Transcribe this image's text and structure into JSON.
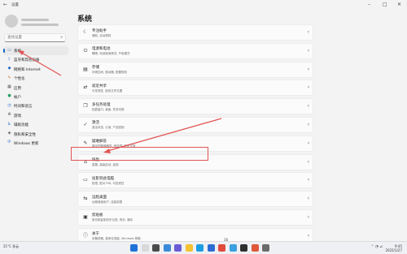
{
  "titlebar": {
    "title": "设置"
  },
  "search": {
    "placeholder": "查找设置"
  },
  "sidebar": {
    "items": [
      {
        "label": "系统",
        "icon": "system-icon",
        "active": true
      },
      {
        "label": "蓝牙和其他设备",
        "icon": "bluetooth-icon"
      },
      {
        "label": "网络和 Internet",
        "icon": "network-icon"
      },
      {
        "label": "个性化",
        "icon": "personalization-icon"
      },
      {
        "label": "应用",
        "icon": "apps-icon"
      },
      {
        "label": "帐户",
        "icon": "account-icon"
      },
      {
        "label": "时间和语言",
        "icon": "time-icon"
      },
      {
        "label": "游戏",
        "icon": "gaming-icon"
      },
      {
        "label": "辅助功能",
        "icon": "accessibility-icon"
      },
      {
        "label": "隐私和安全性",
        "icon": "privacy-icon"
      },
      {
        "label": "Windows 更新",
        "icon": "update-icon"
      }
    ]
  },
  "main": {
    "title": "系统",
    "rows": [
      {
        "title": "专注助手",
        "subtitle": "通知, 自动规则",
        "icon": "focus-icon"
      },
      {
        "title": "电源和电池",
        "subtitle": "睡眠, 电池使用情况, 节电模式",
        "icon": "power-icon"
      },
      {
        "title": "存储",
        "subtitle": "存储空间, 驱动器, 配置规则",
        "icon": "storage-icon"
      },
      {
        "title": "就近共享",
        "subtitle": "可发现性, 接收文件位置",
        "icon": "nearby-share-icon"
      },
      {
        "title": "多任务处理",
        "subtitle": "贴靠窗口, 桌面, 任务切换",
        "icon": "multitasking-icon"
      },
      {
        "title": "激活",
        "subtitle": "激活状态, 订阅, 产品密钥",
        "icon": "activation-icon"
      },
      {
        "title": "疑难解答",
        "subtitle": "建议的疑难解答, 首选项, 历史记录",
        "icon": "troubleshoot-icon"
      },
      {
        "title": "恢复",
        "subtitle": "重置, 高级启动, 返回",
        "icon": "recovery-icon"
      },
      {
        "title": "投影到此电脑",
        "subtitle": "权限, 配对 PIN, 可发现性",
        "icon": "projection-icon"
      },
      {
        "title": "远程桌面",
        "subtitle": "远程桌面用户, 连接权限",
        "icon": "remote-desktop-icon"
      },
      {
        "title": "剪贴板",
        "subtitle": "剪切和复制历史记录, 同步, 清除",
        "icon": "clipboard-icon"
      },
      {
        "title": "关于",
        "subtitle": "设备规格, 重命名电脑, Windows 规格",
        "icon": "about-icon"
      }
    ]
  },
  "page_number": "16",
  "taskbar": {
    "weather": "21°C 多云",
    "time": "9:45",
    "date": "2022/1/27",
    "apps": [
      "start-icon",
      "search-icon",
      "task-view-icon",
      "widgets-icon",
      "chat-icon",
      "explorer-icon",
      "edge-icon",
      "store-icon",
      "chrome-icon",
      "photos-icon",
      "terminal-icon",
      "music-icon",
      "settings-icon"
    ]
  },
  "colors": {
    "accent": "#1466c8",
    "annotation": "#e25555"
  }
}
